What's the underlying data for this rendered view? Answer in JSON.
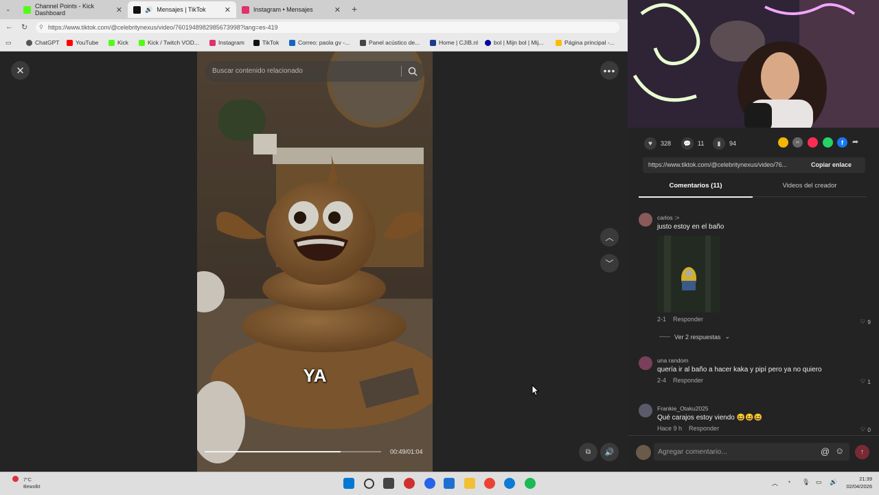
{
  "browser": {
    "tabs": [
      {
        "label": "Channel Points - Kick Dashboard",
        "color": "#53fc18"
      },
      {
        "label": "Mensajes | TikTok",
        "color": "#111111"
      },
      {
        "label": "Instagram • Mensajes",
        "color": "#e1306c"
      }
    ],
    "url": "https://www.tiktok.com/@celebritynexus/video/7601948982985673998?lang=es-419",
    "bookmarks": [
      {
        "label": "ChatGPT",
        "color": "#555555"
      },
      {
        "label": "YouTube",
        "color": "#ff0000"
      },
      {
        "label": "Kick",
        "color": "#53fc18"
      },
      {
        "label": "Kick / Twitch VOD...",
        "color": "#53fc18"
      },
      {
        "label": "Instagram",
        "color": "#e1306c"
      },
      {
        "label": "TikTok",
        "color": "#111111"
      },
      {
        "label": "Correo: paola gv -...",
        "color": "#1565c0"
      },
      {
        "label": "Panel acústico de...",
        "color": "#444444"
      },
      {
        "label": "Home | CJIB.nl",
        "color": "#1b3a8c"
      },
      {
        "label": "bol | Mijn bol | Mij...",
        "color": "#0000a4"
      },
      {
        "label": "Página principal -...",
        "color": "#fbbc04"
      }
    ]
  },
  "viewer": {
    "search_placeholder": "Buscar contenido relacionado",
    "caption": "YA",
    "time": "00:49/01:04",
    "progress": 0.77
  },
  "stats": {
    "likes": "328",
    "comments": "11",
    "saves": "94"
  },
  "share": {
    "link": "https://www.tiktok.com/@celebritynexus/video/76...",
    "copy_label": "Copiar enlace",
    "colors": [
      "#f2b705",
      "#666666",
      "#fe2c55",
      "#25d366",
      "#1877f2"
    ]
  },
  "tabs": {
    "comments": "Comentarios (11)",
    "creator": "Videos del creador"
  },
  "comments": [
    {
      "user": "carlos :>",
      "text": "justo estoy en el baño",
      "date": "2-1",
      "reply": "Responder",
      "likes": "9",
      "replies": "Ver 2 respuestas"
    },
    {
      "user": "una random",
      "text": "quería ir al baño a hacer kaka y pipí pero ya no quiero",
      "date": "2-4",
      "reply": "Responder",
      "likes": "1"
    },
    {
      "user": "Frankie_Otaku2025",
      "text": "Qué carajos estoy viendo 😆😆😆",
      "date": "Hace 9 h",
      "reply": "Responder",
      "likes": "0"
    }
  ],
  "add_comment_placeholder": "Agregar comentario...",
  "taskbar": {
    "weather_temp": "7°C",
    "weather_text": "Bewolkt",
    "time": "21:39",
    "date": "02/04/2026",
    "app_colors": [
      "#0078d4",
      "#333333",
      "#444444",
      "#d03030",
      "#2563eb",
      "#1f6fd1",
      "#f2c036",
      "#ea4335",
      "#0c7bd6",
      "#1db954"
    ]
  }
}
